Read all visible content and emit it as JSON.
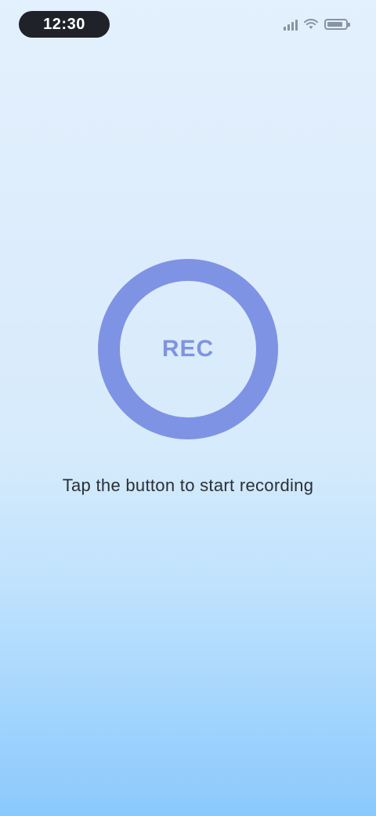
{
  "status_bar": {
    "time": "12:30",
    "battery_level": 0.85,
    "icons": [
      "signal-icon",
      "wifi-icon",
      "battery-icon"
    ]
  },
  "main": {
    "button_label": "REC",
    "caption": "Tap the button to start recording"
  },
  "colors": {
    "accent": "#7f93e4",
    "status_pill": "#1f2228",
    "background_top": "#e3f0fd",
    "background_bottom": "#8ac9fc"
  }
}
